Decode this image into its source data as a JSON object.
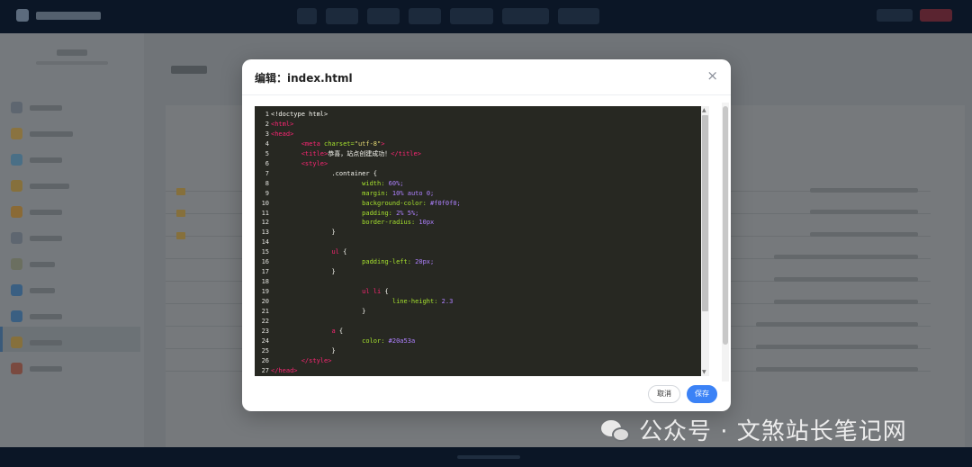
{
  "modal": {
    "title": "编辑：index.html",
    "close_symbol": "×",
    "cancel_label": "取消",
    "save_label": "保存"
  },
  "editor": {
    "line_numbers": [
      "1",
      "2",
      "3",
      "4",
      "5",
      "6",
      "7",
      "8",
      "9",
      "10",
      "11",
      "12",
      "13",
      "14",
      "15",
      "16",
      "17",
      "18",
      "19",
      "20",
      "21",
      "22",
      "23",
      "24",
      "25",
      "26",
      "27"
    ],
    "lines": [
      "<!doctype html>",
      "<html>",
      "<head>",
      "        <meta charset=\"utf-8\">",
      "        <title>恭喜，站点创建成功！</title>",
      "        <style>",
      "                .container {",
      "                        width: 60%;",
      "                        margin: 10% auto 0;",
      "                        background-color: #f0f0f0;",
      "                        padding: 2% 5%;",
      "                        border-radius: 10px",
      "                }",
      "",
      "                ul {",
      "                        padding-left: 20px;",
      "                }",
      "",
      "                        ul li {",
      "                                line-height: 2.3",
      "                        }",
      "",
      "                a {",
      "                        color: #20a53a",
      "                }",
      "        </style>",
      "</head>"
    ]
  },
  "watermark": {
    "text": "公众号 · 文煞站长笔记网",
    "icon": "wechat-icon"
  },
  "colors": {
    "tag": "#f92672",
    "attr": "#a6e22e",
    "string": "#e6db74",
    "number": "#ae81ff",
    "editor_bg": "#272822",
    "primary": "#3b82f6"
  }
}
